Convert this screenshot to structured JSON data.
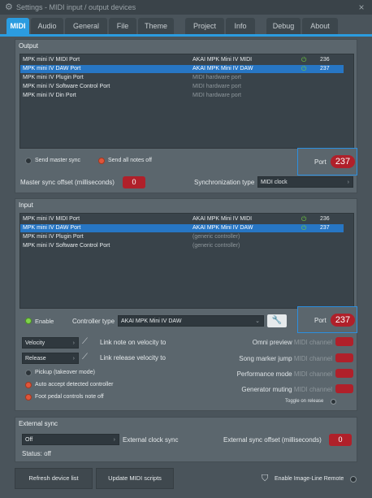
{
  "window": {
    "title": "Settings - MIDI input / output devices"
  },
  "tabs": [
    "MIDI",
    "Audio",
    "General",
    "File",
    "Theme",
    "Project",
    "Info",
    "Debug",
    "About"
  ],
  "output": {
    "title": "Output",
    "rows": [
      {
        "name": "MPK mini IV MIDI Port",
        "device": "AKAI MPK Mini IV MIDI",
        "port": "236"
      },
      {
        "name": "MPK mini IV DAW Port",
        "device": "AKAI MPK Mini IV DAW",
        "port": "237"
      },
      {
        "name": "MPK mini IV Plugin Port",
        "device": "MIDI hardware port",
        "port": ""
      },
      {
        "name": "MPK mini IV Software Control Port",
        "device": "MIDI hardware port",
        "port": ""
      },
      {
        "name": "MPK mini IV Din Port",
        "device": "MIDI hardware port",
        "port": ""
      }
    ],
    "send_master_sync": "Send master sync",
    "send_all_notes_off": "Send all notes off",
    "port_label": "Port",
    "port_value": "237",
    "master_sync_offset_label": "Master sync offset (milliseconds)",
    "master_sync_offset_value": "0",
    "sync_type_label": "Synchronization type",
    "sync_type_value": "MIDI clock"
  },
  "input": {
    "title": "Input",
    "rows": [
      {
        "name": "MPK mini IV MIDI Port",
        "device": "AKAI MPK Mini IV MIDI",
        "port": "236"
      },
      {
        "name": "MPK mini IV DAW Port",
        "device": "AKAI MPK Mini IV DAW",
        "port": "237"
      },
      {
        "name": "MPK mini IV Plugin Port",
        "device": "(generic controller)",
        "port": ""
      },
      {
        "name": "MPK mini IV Software Control Port",
        "device": "(generic controller)",
        "port": ""
      }
    ],
    "enable": "Enable",
    "controller_type_label": "Controller type",
    "controller_type_value": "AKAI MPK Mini IV DAW",
    "port_label": "Port",
    "port_value": "237",
    "velocity": "Velocity",
    "link_note_on": "Link note on velocity to",
    "release": "Release",
    "link_release": "Link release velocity to",
    "pickup": "Pickup (takeover mode)",
    "auto_accept": "Auto accept detected controller",
    "foot_pedal": "Foot pedal controls note off",
    "omni_preview": "Omni preview",
    "song_marker_jump": "Song marker jump",
    "performance_mode": "Performance mode",
    "generator_muting": "Generator muting",
    "midi_channel": "MIDI channel",
    "toggle_on_release": "Toggle on release"
  },
  "external_sync": {
    "title": "External sync",
    "mode": "Off",
    "clock_label": "External clock sync",
    "offset_label": "External sync offset (milliseconds)",
    "offset_value": "0",
    "status": "Status: off"
  },
  "footer": {
    "refresh": "Refresh device list",
    "update_scripts": "Update MIDI scripts",
    "enable_remote": "Enable Image-Line Remote"
  },
  "colors": {
    "accent": "#2b9ce0",
    "red": "#b0202a",
    "green": "#6fcf3f",
    "selection": "#2776c4"
  }
}
